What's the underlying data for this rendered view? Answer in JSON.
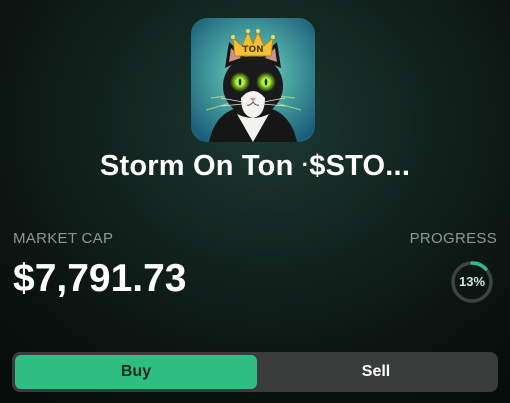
{
  "token": {
    "name": "Storm On Ton",
    "separator": "·",
    "ticker_truncated": "$STO...",
    "logo_text": "TON"
  },
  "stats": {
    "market_cap_label": "MARKET CAP",
    "market_cap_value": "$7,791.73",
    "progress_label": "PROGRESS",
    "progress_text": "13%",
    "progress_fraction": 0.13
  },
  "trade_toggle": {
    "buy_label": "Buy",
    "sell_label": "Sell",
    "selected": "Buy"
  },
  "colors": {
    "accent_green": "#2fbd82",
    "toggle_bg": "#3a3c3b",
    "muted_label": "#8d9893"
  }
}
